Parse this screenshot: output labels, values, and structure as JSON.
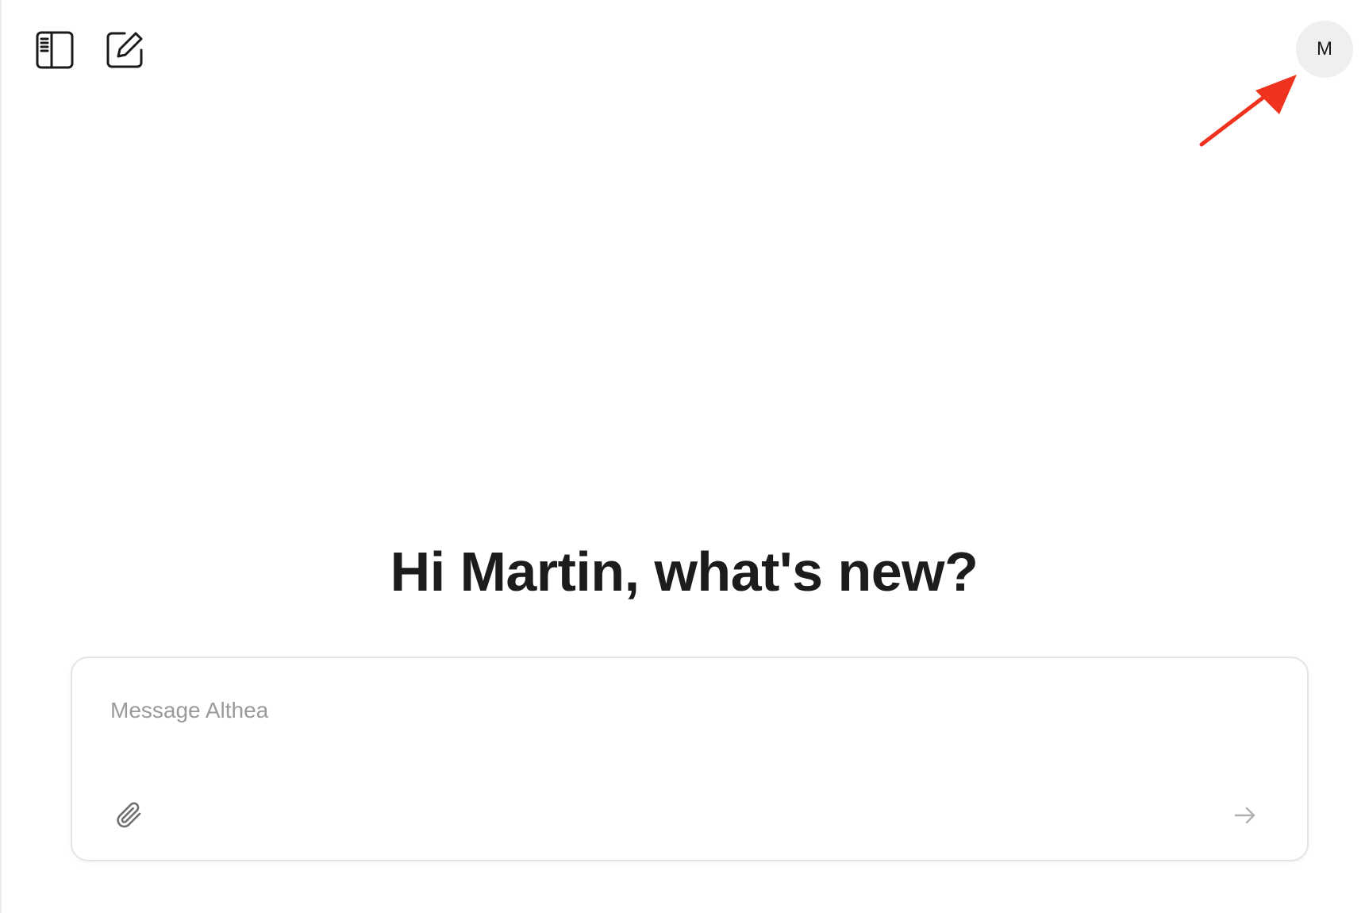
{
  "header": {
    "sidebar_toggle_icon": "sidebar-icon",
    "new_chat_icon": "edit-icon",
    "avatar_initial": "M"
  },
  "main": {
    "greeting": "Hi Martin, what's new?"
  },
  "composer": {
    "placeholder": "Message Althea",
    "value": "",
    "attach_icon": "paperclip-icon",
    "send_icon": "arrow-right-icon"
  },
  "annotation": {
    "arrow_color": "#f0331e"
  }
}
